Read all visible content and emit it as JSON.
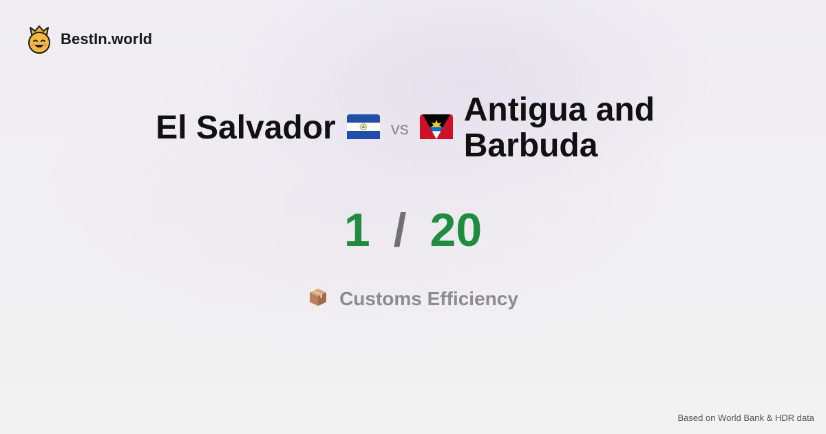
{
  "brand": {
    "name": "BestIn.world",
    "icon": "crowned-smiley-icon"
  },
  "comparison": {
    "left": {
      "name": "El Salvador",
      "flag": "el-salvador-flag-icon"
    },
    "vs_label": "vs",
    "right": {
      "name_line1": "Antigua and",
      "name_line2": "Barbuda",
      "flag": "antigua-barbuda-flag-icon"
    }
  },
  "score": {
    "left": "1",
    "separator": "/",
    "right": "20",
    "color": "#1e8e3e"
  },
  "metric": {
    "icon": "package-icon",
    "label": "Customs Efficiency"
  },
  "footer": {
    "source": "Based on World Bank & HDR data"
  }
}
